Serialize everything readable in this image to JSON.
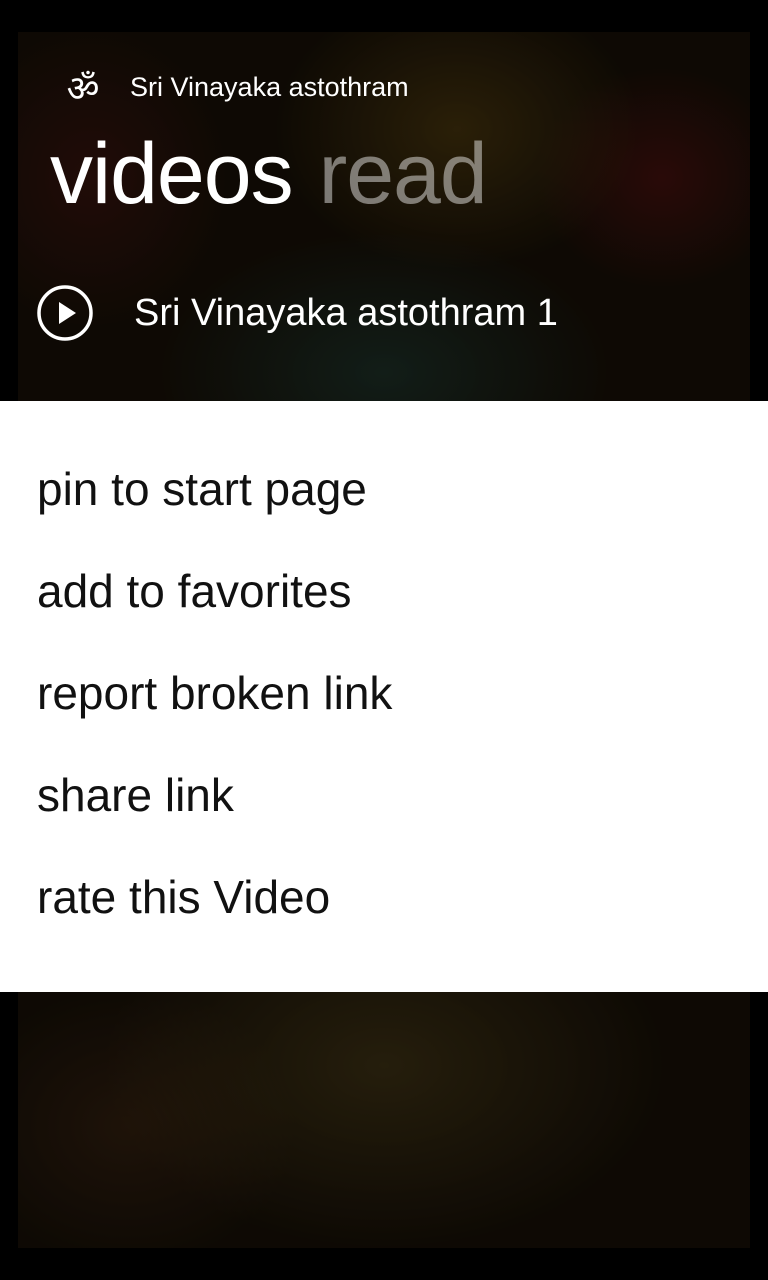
{
  "header": {
    "app_icon": "om-icon",
    "app_icon_glyph": "ॐ",
    "app_title": "Sri Vinayaka astothram",
    "pivot_tabs": [
      {
        "label": "videos",
        "active": true
      },
      {
        "label": "read",
        "active": false
      }
    ]
  },
  "video_list": {
    "items": [
      {
        "icon": "play-icon",
        "title": "Sri Vinayaka astothram 1"
      }
    ]
  },
  "context_menu": {
    "items": [
      {
        "label": "pin to start page"
      },
      {
        "label": "add to favorites"
      },
      {
        "label": "report broken link"
      },
      {
        "label": "share link"
      },
      {
        "label": "rate this Video"
      }
    ]
  },
  "colors": {
    "menu_background": "#ffffff",
    "menu_text": "#111111",
    "header_text": "#ffffff",
    "inactive_pivot": "rgba(255,255,255,0.45)"
  }
}
